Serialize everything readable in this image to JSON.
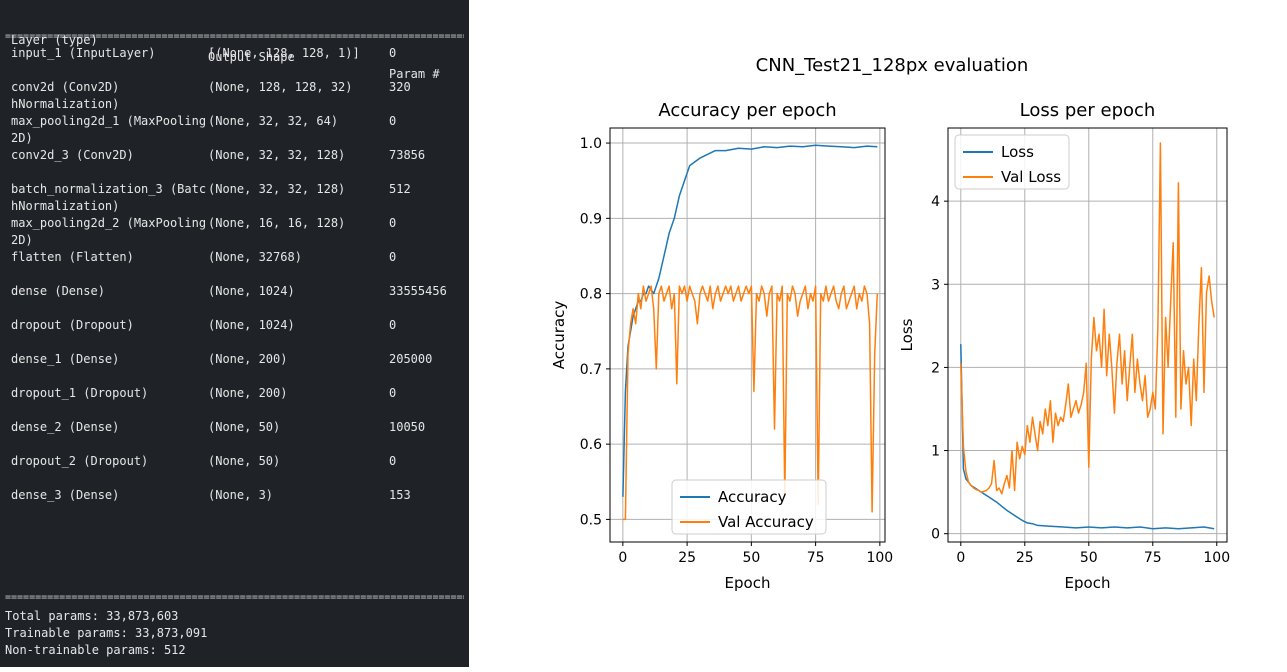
{
  "summary": {
    "headers": [
      "Layer (type)",
      "Output Shape",
      "Param #"
    ],
    "rows": [
      {
        "layer": [
          "input_1 (InputLayer)"
        ],
        "shape": "[(None, 128, 128, 1)]",
        "params": "0"
      },
      {
        "layer": [
          "conv2d (Conv2D)",
          "hNormalization)"
        ],
        "shape": "(None, 128, 128, 32)",
        "params": "320"
      },
      {
        "layer": [
          "max_pooling2d_1 (MaxPooling",
          "2D)"
        ],
        "shape": "(None, 32, 32, 64)",
        "params": "0"
      },
      {
        "layer": [
          "conv2d_3 (Conv2D)"
        ],
        "shape": "(None, 32, 32, 128)",
        "params": "73856"
      },
      {
        "layer": [
          "batch_normalization_3 (Batc",
          "hNormalization)"
        ],
        "shape": "(None, 32, 32, 128)",
        "params": "512"
      },
      {
        "layer": [
          "max_pooling2d_2 (MaxPooling",
          "2D)"
        ],
        "shape": "(None, 16, 16, 128)",
        "params": "0"
      },
      {
        "layer": [
          "flatten (Flatten)"
        ],
        "shape": "(None, 32768)",
        "params": "0"
      },
      {
        "layer": [
          "dense (Dense)"
        ],
        "shape": "(None, 1024)",
        "params": "33555456"
      },
      {
        "layer": [
          "dropout (Dropout)"
        ],
        "shape": "(None, 1024)",
        "params": "0"
      },
      {
        "layer": [
          "dense_1 (Dense)"
        ],
        "shape": "(None, 200)",
        "params": "205000"
      },
      {
        "layer": [
          "dropout_1 (Dropout)"
        ],
        "shape": "(None, 200)",
        "params": "0"
      },
      {
        "layer": [
          "dense_2 (Dense)"
        ],
        "shape": "(None, 50)",
        "params": "10050"
      },
      {
        "layer": [
          "dropout_2 (Dropout)"
        ],
        "shape": "(None, 50)",
        "params": "0"
      },
      {
        "layer": [
          "dense_3 (Dense)"
        ],
        "shape": "(None, 3)",
        "params": "153"
      }
    ],
    "totals": [
      "Total params: 33,873,603",
      "Trainable params: 33,873,091",
      "Non-trainable params: 512"
    ]
  },
  "figure": {
    "suptitle": "CNN_Test21_128px evaluation",
    "colors": {
      "blue": "#1f77b4",
      "orange": "#ff7f0e"
    }
  },
  "chart_data": [
    {
      "type": "line",
      "title": "Accuracy per epoch",
      "xlabel": "Epoch",
      "ylabel": "Accuracy",
      "xlim": [
        -5,
        102
      ],
      "ylim": [
        0.47,
        1.02
      ],
      "xticks": [
        0,
        25,
        50,
        75,
        100
      ],
      "yticks": [
        0.5,
        0.6,
        0.7,
        0.8,
        0.9,
        1.0
      ],
      "grid": true,
      "legend": "bottom-center",
      "series": [
        {
          "name": "Accuracy",
          "color": "#1f77b4",
          "x": [
            0,
            1,
            2,
            3,
            4,
            5,
            6,
            7,
            8,
            9,
            10,
            12,
            14,
            16,
            18,
            20,
            22,
            24,
            26,
            28,
            30,
            33,
            36,
            40,
            45,
            50,
            55,
            60,
            65,
            70,
            75,
            80,
            85,
            90,
            95,
            99
          ],
          "y": [
            0.53,
            0.67,
            0.73,
            0.75,
            0.77,
            0.78,
            0.79,
            0.79,
            0.8,
            0.8,
            0.81,
            0.8,
            0.82,
            0.85,
            0.88,
            0.9,
            0.93,
            0.95,
            0.97,
            0.975,
            0.98,
            0.985,
            0.99,
            0.99,
            0.993,
            0.992,
            0.995,
            0.994,
            0.996,
            0.995,
            0.997,
            0.996,
            0.995,
            0.994,
            0.996,
            0.995
          ]
        },
        {
          "name": "Val Accuracy",
          "color": "#ff7f0e",
          "x": [
            0,
            1,
            2,
            3,
            4,
            5,
            6,
            7,
            8,
            9,
            10,
            11,
            12,
            13,
            14,
            15,
            16,
            17,
            18,
            19,
            20,
            21,
            22,
            23,
            24,
            25,
            26,
            27,
            28,
            29,
            30,
            31,
            32,
            33,
            34,
            35,
            36,
            37,
            38,
            39,
            40,
            41,
            42,
            43,
            44,
            45,
            46,
            47,
            48,
            49,
            50,
            51,
            52,
            53,
            54,
            55,
            56,
            57,
            58,
            59,
            60,
            61,
            62,
            63,
            64,
            65,
            66,
            67,
            68,
            69,
            70,
            71,
            72,
            73,
            74,
            75,
            76,
            77,
            78,
            79,
            80,
            81,
            82,
            83,
            84,
            85,
            86,
            87,
            88,
            89,
            90,
            91,
            92,
            93,
            94,
            95,
            96,
            97,
            98,
            99
          ],
          "y": [
            0.5,
            0.5,
            0.72,
            0.76,
            0.78,
            0.76,
            0.8,
            0.78,
            0.81,
            0.79,
            0.8,
            0.81,
            0.78,
            0.7,
            0.8,
            0.81,
            0.79,
            0.8,
            0.81,
            0.78,
            0.8,
            0.68,
            0.81,
            0.8,
            0.81,
            0.79,
            0.81,
            0.8,
            0.79,
            0.76,
            0.8,
            0.81,
            0.8,
            0.79,
            0.81,
            0.78,
            0.8,
            0.81,
            0.79,
            0.8,
            0.81,
            0.8,
            0.81,
            0.79,
            0.8,
            0.81,
            0.79,
            0.8,
            0.81,
            0.8,
            0.81,
            0.67,
            0.8,
            0.79,
            0.81,
            0.8,
            0.77,
            0.8,
            0.81,
            0.62,
            0.8,
            0.79,
            0.81,
            0.53,
            0.8,
            0.79,
            0.81,
            0.8,
            0.77,
            0.79,
            0.8,
            0.81,
            0.78,
            0.8,
            0.79,
            0.81,
            0.52,
            0.8,
            0.79,
            0.81,
            0.79,
            0.8,
            0.81,
            0.79,
            0.78,
            0.8,
            0.81,
            0.78,
            0.79,
            0.8,
            0.81,
            0.78,
            0.8,
            0.79,
            0.81,
            0.8,
            0.76,
            0.51,
            0.72,
            0.8
          ]
        }
      ]
    },
    {
      "type": "line",
      "title": "Loss per epoch",
      "xlabel": "Epoch",
      "ylabel": "Loss",
      "xlim": [
        -5,
        104
      ],
      "ylim": [
        -0.1,
        4.88
      ],
      "xticks": [
        0,
        25,
        50,
        75,
        100
      ],
      "yticks": [
        0,
        1,
        2,
        3,
        4
      ],
      "grid": true,
      "legend": "top-left",
      "series": [
        {
          "name": "Loss",
          "color": "#1f77b4",
          "x": [
            0,
            1,
            2,
            3,
            4,
            5,
            6,
            7,
            8,
            9,
            10,
            12,
            14,
            16,
            18,
            20,
            22,
            24,
            26,
            28,
            30,
            35,
            40,
            45,
            50,
            55,
            60,
            65,
            70,
            75,
            80,
            85,
            90,
            95,
            99
          ],
          "y": [
            2.28,
            0.78,
            0.66,
            0.62,
            0.58,
            0.56,
            0.54,
            0.52,
            0.5,
            0.48,
            0.46,
            0.42,
            0.38,
            0.33,
            0.28,
            0.24,
            0.2,
            0.16,
            0.13,
            0.12,
            0.1,
            0.09,
            0.08,
            0.07,
            0.08,
            0.07,
            0.08,
            0.07,
            0.08,
            0.06,
            0.07,
            0.06,
            0.07,
            0.08,
            0.06
          ]
        },
        {
          "name": "Val Loss",
          "color": "#ff7f0e",
          "x": [
            0,
            1,
            2,
            3,
            4,
            5,
            6,
            7,
            8,
            9,
            10,
            11,
            12,
            13,
            14,
            15,
            16,
            17,
            18,
            19,
            20,
            21,
            22,
            23,
            24,
            25,
            26,
            27,
            28,
            29,
            30,
            31,
            32,
            33,
            34,
            35,
            36,
            37,
            38,
            39,
            40,
            41,
            42,
            43,
            44,
            45,
            46,
            47,
            48,
            49,
            50,
            51,
            52,
            53,
            54,
            55,
            56,
            57,
            58,
            59,
            60,
            61,
            62,
            63,
            64,
            65,
            66,
            67,
            68,
            69,
            70,
            71,
            72,
            73,
            74,
            75,
            76,
            77,
            78,
            79,
            80,
            81,
            82,
            83,
            84,
            85,
            86,
            87,
            88,
            89,
            90,
            91,
            92,
            93,
            94,
            95,
            96,
            97,
            98,
            99
          ],
          "y": [
            2.05,
            1.05,
            0.75,
            0.62,
            0.58,
            0.55,
            0.53,
            0.52,
            0.5,
            0.51,
            0.52,
            0.55,
            0.6,
            0.88,
            0.52,
            0.55,
            0.48,
            0.6,
            0.7,
            0.55,
            1.0,
            0.52,
            1.1,
            0.9,
            1.05,
            0.95,
            1.3,
            1.1,
            1.4,
            1.2,
            1.0,
            1.35,
            1.2,
            1.5,
            1.3,
            1.6,
            1.1,
            1.45,
            1.3,
            1.4,
            1.35,
            1.55,
            1.8,
            1.4,
            1.5,
            1.6,
            1.45,
            1.55,
            1.7,
            2.05,
            0.8,
            2.1,
            2.6,
            2.2,
            2.4,
            2.0,
            2.7,
            1.9,
            2.4,
            2.0,
            1.45,
            2.05,
            2.4,
            1.8,
            2.2,
            1.6,
            2.0,
            2.4,
            1.7,
            2.1,
            1.8,
            1.6,
            1.9,
            1.4,
            1.5,
            1.7,
            1.5,
            2.5,
            4.7,
            1.2,
            2.6,
            2.0,
            2.8,
            3.5,
            1.4,
            4.22,
            1.5,
            2.2,
            1.8,
            2.0,
            1.3,
            2.1,
            1.6,
            2.5,
            3.2,
            1.7,
            2.9,
            3.1,
            2.8,
            2.6
          ]
        }
      ]
    }
  ]
}
